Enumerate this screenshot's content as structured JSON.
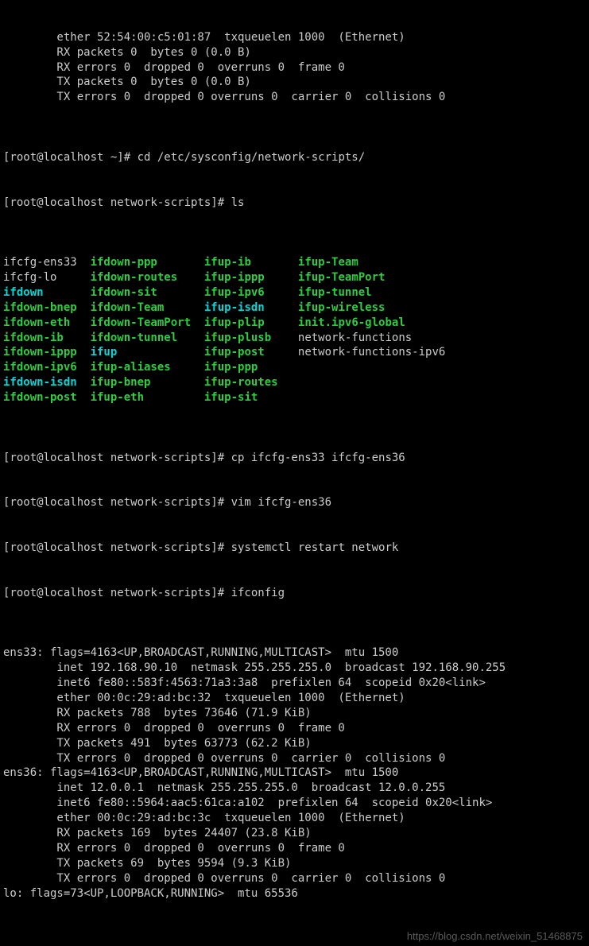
{
  "pre_output": [
    "        ether 52:54:00:c5:01:87  txqueuelen 1000  (Ethernet)",
    "        RX packets 0  bytes 0 (0.0 B)",
    "        RX errors 0  dropped 0  overruns 0  frame 0",
    "        TX packets 0  bytes 0 (0.0 B)",
    "        TX errors 0  dropped 0 overruns 0  carrier 0  collisions 0",
    ""
  ],
  "cmd1": {
    "prompt": "[root@localhost ~]# ",
    "command": "cd /etc/sysconfig/network-scripts/"
  },
  "cmd2": {
    "prompt": "[root@localhost network-scripts]# ",
    "command": "ls"
  },
  "ls_rows": [
    [
      {
        "text": "ifcfg-ens33",
        "cls": ""
      },
      {
        "text": "ifdown-ppp",
        "cls": "green"
      },
      {
        "text": "ifup-ib",
        "cls": "green"
      },
      {
        "text": "ifup-Team",
        "cls": "green"
      }
    ],
    [
      {
        "text": "ifcfg-lo",
        "cls": ""
      },
      {
        "text": "ifdown-routes",
        "cls": "green"
      },
      {
        "text": "ifup-ippp",
        "cls": "green"
      },
      {
        "text": "ifup-TeamPort",
        "cls": "green"
      }
    ],
    [
      {
        "text": "ifdown",
        "cls": "cyan"
      },
      {
        "text": "ifdown-sit",
        "cls": "green"
      },
      {
        "text": "ifup-ipv6",
        "cls": "green"
      },
      {
        "text": "ifup-tunnel",
        "cls": "green"
      }
    ],
    [
      {
        "text": "ifdown-bnep",
        "cls": "green"
      },
      {
        "text": "ifdown-Team",
        "cls": "green"
      },
      {
        "text": "ifup-isdn",
        "cls": "cyan"
      },
      {
        "text": "ifup-wireless",
        "cls": "green"
      }
    ],
    [
      {
        "text": "ifdown-eth",
        "cls": "green"
      },
      {
        "text": "ifdown-TeamPort",
        "cls": "green"
      },
      {
        "text": "ifup-plip",
        "cls": "green"
      },
      {
        "text": "init.ipv6-global",
        "cls": "green"
      }
    ],
    [
      {
        "text": "ifdown-ib",
        "cls": "green"
      },
      {
        "text": "ifdown-tunnel",
        "cls": "green"
      },
      {
        "text": "ifup-plusb",
        "cls": "green"
      },
      {
        "text": "network-functions",
        "cls": ""
      }
    ],
    [
      {
        "text": "ifdown-ippp",
        "cls": "green"
      },
      {
        "text": "ifup",
        "cls": "cyan"
      },
      {
        "text": "ifup-post",
        "cls": "green"
      },
      {
        "text": "network-functions-ipv6",
        "cls": ""
      }
    ],
    [
      {
        "text": "ifdown-ipv6",
        "cls": "green"
      },
      {
        "text": "ifup-aliases",
        "cls": "green"
      },
      {
        "text": "ifup-ppp",
        "cls": "green"
      },
      {
        "text": "",
        "cls": ""
      }
    ],
    [
      {
        "text": "ifdown-isdn",
        "cls": "cyan"
      },
      {
        "text": "ifup-bnep",
        "cls": "green"
      },
      {
        "text": "ifup-routes",
        "cls": "green"
      },
      {
        "text": "",
        "cls": ""
      }
    ],
    [
      {
        "text": "ifdown-post",
        "cls": "green"
      },
      {
        "text": "ifup-eth",
        "cls": "green"
      },
      {
        "text": "ifup-sit",
        "cls": "green"
      },
      {
        "text": "",
        "cls": ""
      }
    ]
  ],
  "ls_cols": [
    13,
    17,
    14,
    0
  ],
  "cmd3": {
    "prompt": "[root@localhost network-scripts]# ",
    "command": "cp ifcfg-ens33 ifcfg-ens36"
  },
  "cmd4": {
    "prompt": "[root@localhost network-scripts]# ",
    "command": "vim ifcfg-ens36"
  },
  "cmd5": {
    "prompt": "[root@localhost network-scripts]# ",
    "command": "systemctl restart network"
  },
  "cmd6": {
    "prompt": "[root@localhost network-scripts]# ",
    "command": "ifconfig"
  },
  "ifconfig_output": [
    "ens33: flags=4163<UP,BROADCAST,RUNNING,MULTICAST>  mtu 1500",
    "        inet 192.168.90.10  netmask 255.255.255.0  broadcast 192.168.90.255",
    "        inet6 fe80::583f:4563:71a3:3a8  prefixlen 64  scopeid 0x20<link>",
    "        ether 00:0c:29:ad:bc:32  txqueuelen 1000  (Ethernet)",
    "        RX packets 788  bytes 73646 (71.9 KiB)",
    "        RX errors 0  dropped 0  overruns 0  frame 0",
    "        TX packets 491  bytes 63773 (62.2 KiB)",
    "        TX errors 0  dropped 0 overruns 0  carrier 0  collisions 0",
    "",
    "ens36: flags=4163<UP,BROADCAST,RUNNING,MULTICAST>  mtu 1500",
    "        inet 12.0.0.1  netmask 255.255.255.0  broadcast 12.0.0.255",
    "        inet6 fe80::5964:aac5:61ca:a102  prefixlen 64  scopeid 0x20<link>",
    "        ether 00:0c:29:ad:bc:3c  txqueuelen 1000  (Ethernet)",
    "        RX packets 169  bytes 24407 (23.8 KiB)",
    "        RX errors 0  dropped 0  overruns 0  frame 0",
    "        TX packets 69  bytes 9594 (9.3 KiB)",
    "        TX errors 0  dropped 0 overruns 0  carrier 0  collisions 0",
    "",
    "lo: flags=73<UP,LOOPBACK,RUNNING>  mtu 65536"
  ],
  "watermark": "https://blog.csdn.net/weixin_51468875"
}
